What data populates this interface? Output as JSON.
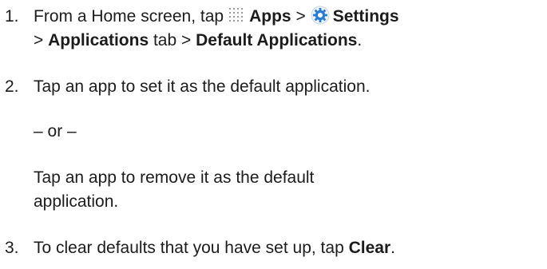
{
  "steps": [
    {
      "number": "1.",
      "line1": {
        "intro": "From a Home screen, tap",
        "apps": "Apps",
        "sep1": ">",
        "settings": "Settings"
      },
      "line2": {
        "sep2": ">",
        "applications": "Applications",
        "tab": "tab >",
        "default_apps": "Default Applications",
        "end": "."
      }
    },
    {
      "number": "2.",
      "text": "Tap an app to set it as the default application.",
      "or": "– or –",
      "alt_line1": "Tap an app to remove it as the default",
      "alt_line2": "application."
    },
    {
      "number": "3.",
      "text": "To clear defaults that you have set up, tap",
      "clear": "Clear",
      "end": "."
    }
  ],
  "icons": {
    "apps": "apps-grid-icon",
    "settings": "settings-gear-icon",
    "settings_color": "#2a7bd4"
  }
}
